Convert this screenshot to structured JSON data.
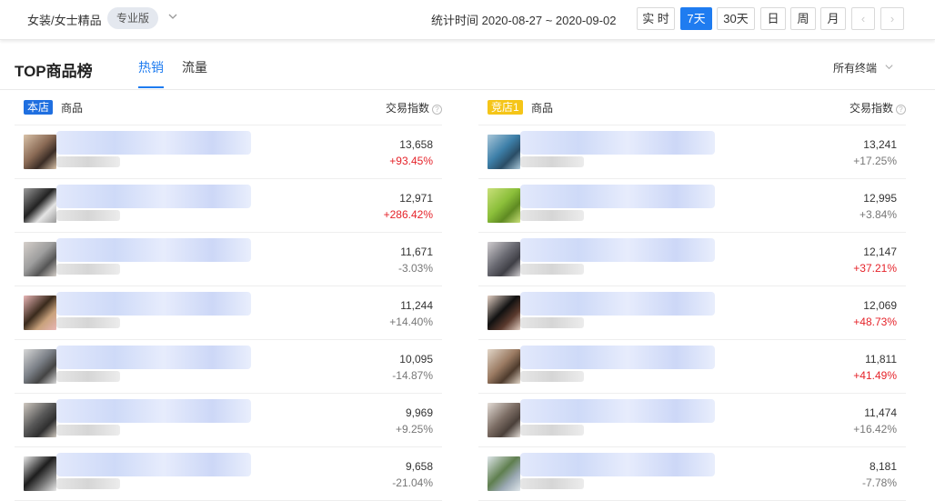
{
  "header": {
    "category": "女装/女士精品",
    "edition": "专业版",
    "stat_time": "统计时间 2020-08-27 ~ 2020-09-02",
    "ranges": [
      "实 时",
      "7天",
      "30天",
      "日",
      "周",
      "月"
    ],
    "active_range": "7天",
    "prev": "‹",
    "next": "›"
  },
  "panel": {
    "title": "TOP商品榜",
    "tabs": [
      "热销",
      "流量"
    ],
    "active_tab": "热销",
    "terminal": "所有终端"
  },
  "own_store": {
    "badge": "本店",
    "product_header": "商品",
    "index_header": "交易指数",
    "rows": [
      {
        "value": "13,658",
        "change": "+93.45%",
        "trend": "up"
      },
      {
        "value": "12,971",
        "change": "+286.42%",
        "trend": "up"
      },
      {
        "value": "11,671",
        "change": "-3.03%",
        "trend": "down"
      },
      {
        "value": "11,244",
        "change": "+14.40%",
        "trend": "down"
      },
      {
        "value": "10,095",
        "change": "-14.87%",
        "trend": "down"
      },
      {
        "value": "9,969",
        "change": "+9.25%",
        "trend": "down"
      },
      {
        "value": "9,658",
        "change": "-21.04%",
        "trend": "down"
      }
    ]
  },
  "rival_store": {
    "badge": "竞店1",
    "product_header": "商品",
    "index_header": "交易指数",
    "rows": [
      {
        "value": "13,241",
        "change": "+17.25%",
        "trend": "down"
      },
      {
        "value": "12,995",
        "change": "+3.84%",
        "trend": "down"
      },
      {
        "value": "12,147",
        "change": "+37.21%",
        "trend": "up"
      },
      {
        "value": "12,069",
        "change": "+48.73%",
        "trend": "up"
      },
      {
        "value": "11,811",
        "change": "+41.49%",
        "trend": "up"
      },
      {
        "value": "11,474",
        "change": "+16.42%",
        "trend": "down"
      },
      {
        "value": "8,181",
        "change": "-7.78%",
        "trend": "down"
      }
    ]
  },
  "colors": {
    "accent": "#1f7cf0",
    "up": "#e5232a",
    "neutral": "#777777",
    "rival_badge": "#f5c518"
  }
}
